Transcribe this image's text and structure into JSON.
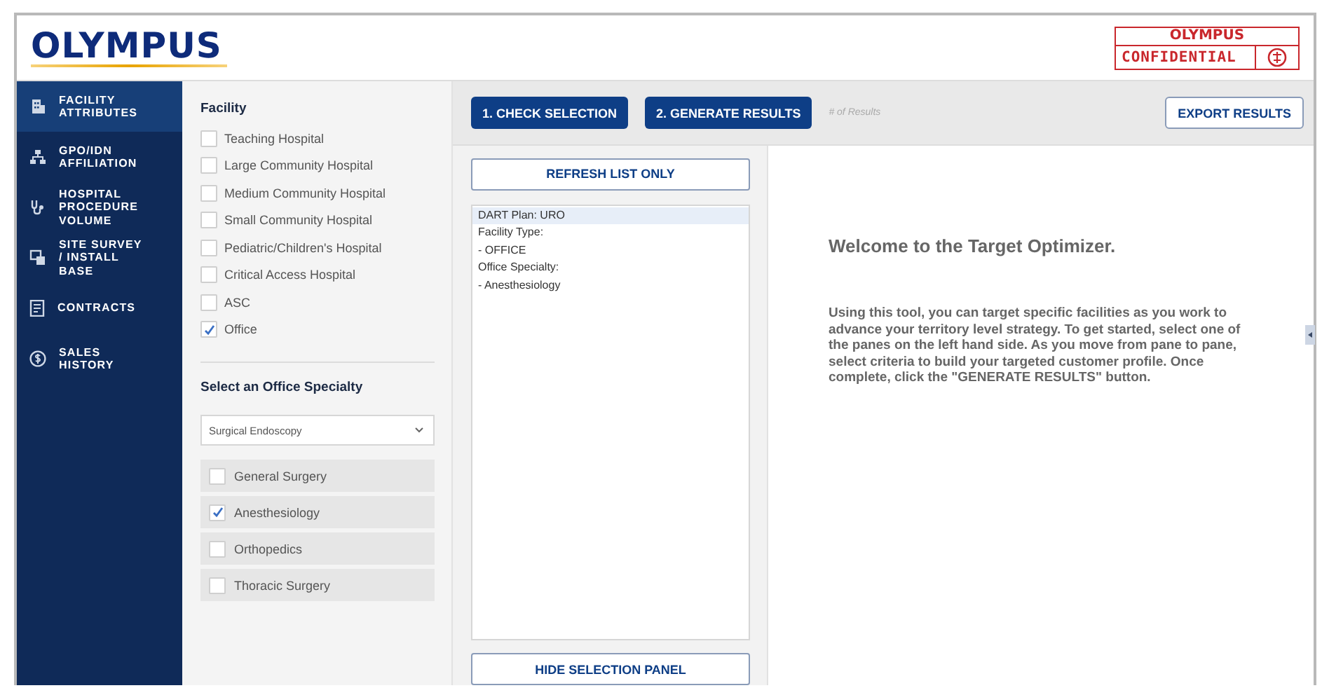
{
  "header": {
    "logo": "OLYMPUS",
    "stamp": {
      "brand": "OLYMPUS",
      "label": "CONFIDENTIAL"
    }
  },
  "sidebar": {
    "items": [
      {
        "label": "FACILITY ATTRIBUTES",
        "selected": true
      },
      {
        "label": "GPO/IDN AFFILIATION",
        "selected": false
      },
      {
        "label": "HOSPITAL PROCEDURE VOLUME",
        "selected": false
      },
      {
        "label": "SITE SURVEY / INSTALL BASE",
        "selected": false
      },
      {
        "label": "CONTRACTS",
        "selected": false
      },
      {
        "label": "SALES HISTORY",
        "selected": false
      }
    ]
  },
  "facility": {
    "title": "Facility",
    "options": [
      {
        "label": "Teaching Hospital",
        "checked": false
      },
      {
        "label": "Large Community Hospital",
        "checked": false
      },
      {
        "label": "Medium Community Hospital",
        "checked": false
      },
      {
        "label": "Small Community Hospital",
        "checked": false
      },
      {
        "label": "Pediatric/Children's Hospital",
        "checked": false
      },
      {
        "label": "Critical Access Hospital",
        "checked": false
      },
      {
        "label": "ASC",
        "checked": false
      },
      {
        "label": "Office",
        "checked": true
      }
    ],
    "specialty": {
      "title": "Select an Office Specialty",
      "dropdown": "Surgical Endoscopy",
      "options": [
        {
          "label": "General Surgery",
          "checked": false
        },
        {
          "label": "Anesthesiology",
          "checked": true
        },
        {
          "label": "Orthopedics",
          "checked": false
        },
        {
          "label": "Thoracic Surgery",
          "checked": false
        }
      ]
    }
  },
  "toolbar": {
    "buttons": [
      "1. CHECK SELECTION",
      "2. GENERATE RESULTS"
    ],
    "results_count": "# of Results",
    "export_button": "EXPORT RESULTS"
  },
  "selection": {
    "refresh_button": "REFRESH LIST ONLY",
    "lines": [
      {
        "text": "DART Plan: URO",
        "selected": true
      },
      {
        "text": "Facility Type:",
        "selected": false
      },
      {
        "text": "- OFFICE",
        "selected": false
      },
      {
        "text": "Office Specialty:",
        "selected": false
      },
      {
        "text": "- Anesthesiology",
        "selected": false
      }
    ],
    "hide_button": "HIDE SELECTION PANEL"
  },
  "welcome": {
    "title": "Welcome to the Target Optimizer.",
    "body": "Using this tool, you can target specific facilities as you work to advance your territory level strategy. To get started, select one of the panes on the left hand side. As you move from pane to pane, select criteria to build your targeted customer profile. Once complete, click the \"GENERATE RESULTS\" button."
  }
}
